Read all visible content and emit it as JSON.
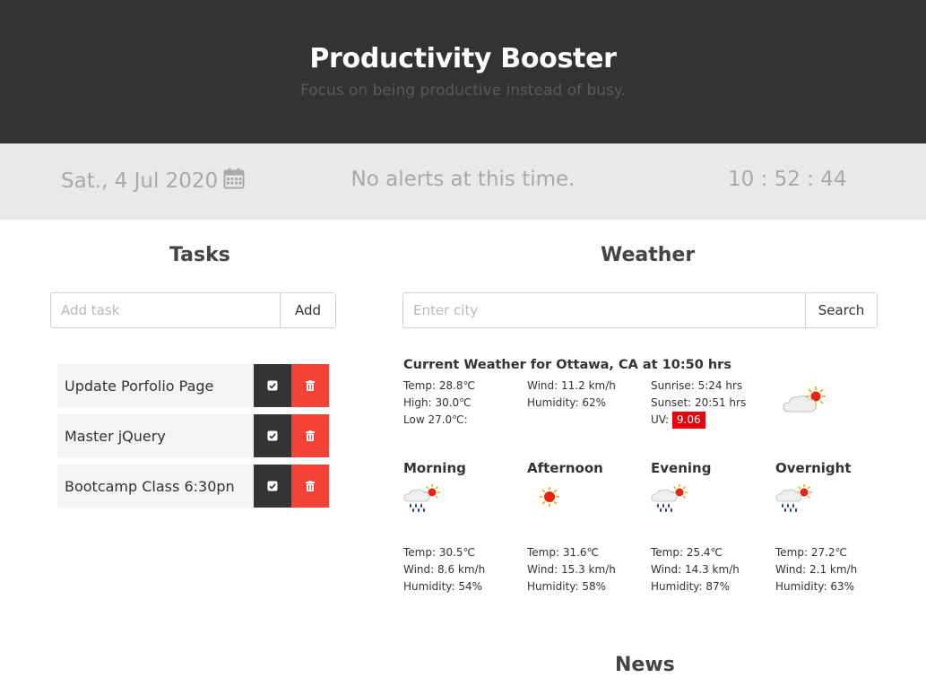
{
  "header": {
    "title": "Productivity Booster",
    "subtitle": "Focus on being productive instead of busy."
  },
  "infobar": {
    "date": "Sat., 4 Jul 2020",
    "alert_text": "No alerts at this time.",
    "clock": "10 : 52 : 44"
  },
  "tasks": {
    "title": "Tasks",
    "input_placeholder": "Add task",
    "add_label": "Add",
    "items": [
      {
        "label": "Update Porfolio Page"
      },
      {
        "label": "Master jQuery"
      },
      {
        "label": "Bootcamp Class 6:30pn"
      }
    ]
  },
  "weather": {
    "title": "Weather",
    "input_placeholder": "Enter city",
    "search_label": "Search",
    "current": {
      "heading": "Current Weather for Ottawa, CA at 10:50 hrs",
      "temp": "Temp:  28.8℃",
      "high": "High:  30.0℃",
      "low": "Low  27.0℃:",
      "wind": "Wind:  11.2 km/h",
      "humidity": "Humidity:  62%",
      "sunrise": "Sunrise:  5:24 hrs",
      "sunset": "Sunset:  20:51 hrs",
      "uv_label": "UV:",
      "uv_value": "9.06",
      "icon": "partly-cloudy-icon"
    },
    "periods": [
      {
        "name": "Morning",
        "icon": "rain-sun-icon",
        "temp": "Temp:   30.5℃",
        "wind": "Wind:   8.6 km/h",
        "humidity": "Humidity:   54%"
      },
      {
        "name": "Afternoon",
        "icon": "sun-icon",
        "temp": "Temp:   31.6℃",
        "wind": "Wind:   15.3 km/h",
        "humidity": "Humidity:   58%"
      },
      {
        "name": "Evening",
        "icon": "rain-sun-icon",
        "temp": "Temp:   25.4℃",
        "wind": "Wind:   14.3 km/h",
        "humidity": "Humidity:   87%"
      },
      {
        "name": "Overnight",
        "icon": "rain-sun-icon",
        "temp": "Temp:   27.2℃",
        "wind": "Wind:   2.1 km/h",
        "humidity": "Humidity:   63%"
      }
    ]
  },
  "news": {
    "title": "News"
  },
  "colors": {
    "header_bg": "#333333",
    "infobar_bg": "#e9e9e9",
    "done_button": "#343434",
    "delete_button": "#f44336",
    "uv_badge": "#e8000b"
  }
}
